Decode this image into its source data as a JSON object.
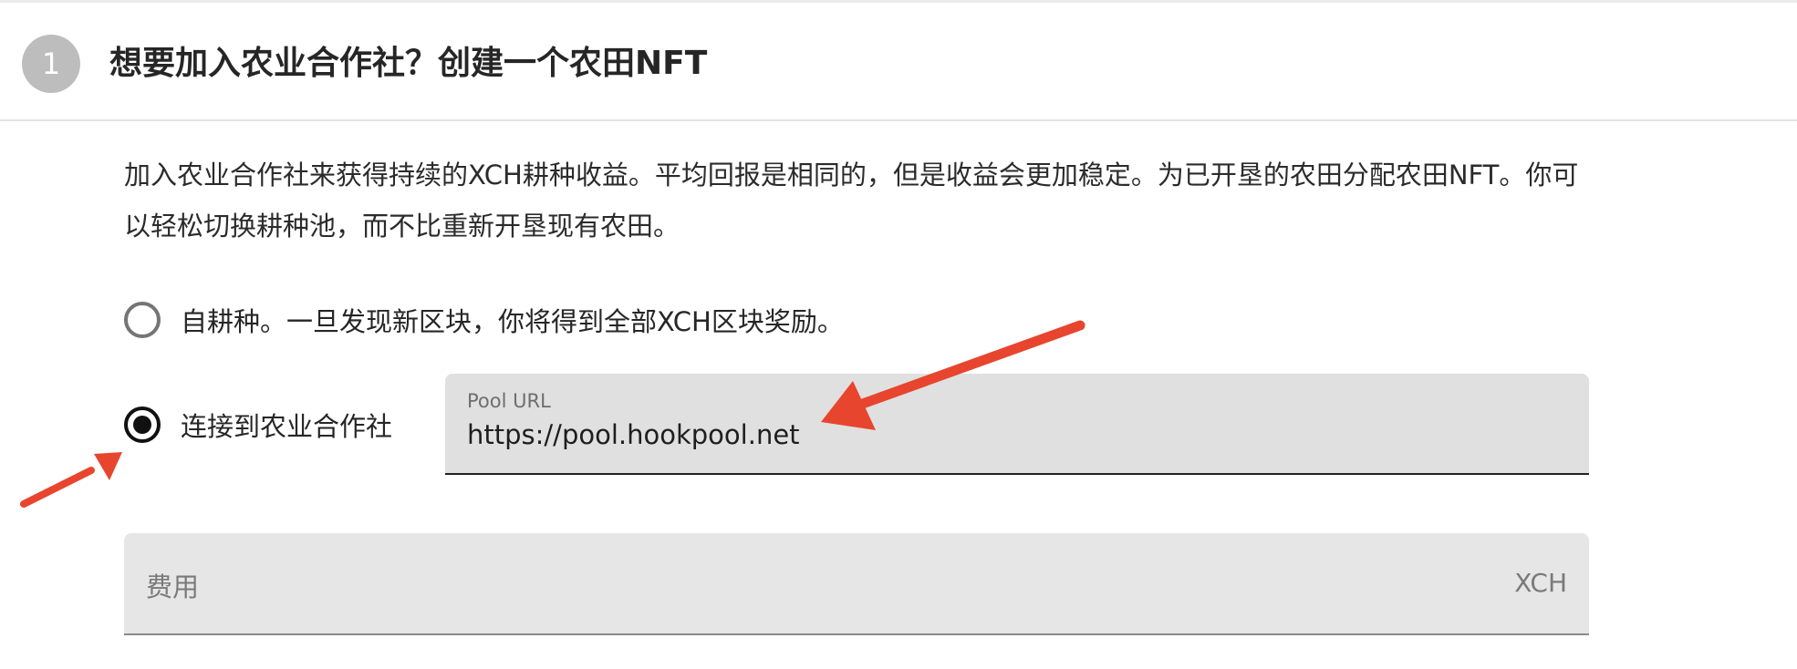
{
  "header": {
    "step_number": "1",
    "title": "想要加入农业合作社？创建一个农田NFT"
  },
  "description": "加入农业合作社来获得持续的XCH耕种收益。平均回报是相同的，但是收益会更加稳定。为已开垦的农田分配农田NFT。你可以轻松切换耕种池，而不比重新开垦现有农田。",
  "options": {
    "self_pool": {
      "label": "自耕种。一旦发现新区块，你将得到全部XCH区块奖励。",
      "selected": false
    },
    "join_pool": {
      "label": "连接到农业合作社",
      "selected": true
    }
  },
  "pool_url_field": {
    "label": "Pool URL",
    "value": "https://pool.hookpool.net"
  },
  "fee_field": {
    "placeholder": "费用",
    "suffix": "XCH"
  },
  "colors": {
    "annotation_arrow": "#e8452f",
    "field_bg": "#e0e0e0",
    "badge_bg": "#bdbdbd"
  }
}
